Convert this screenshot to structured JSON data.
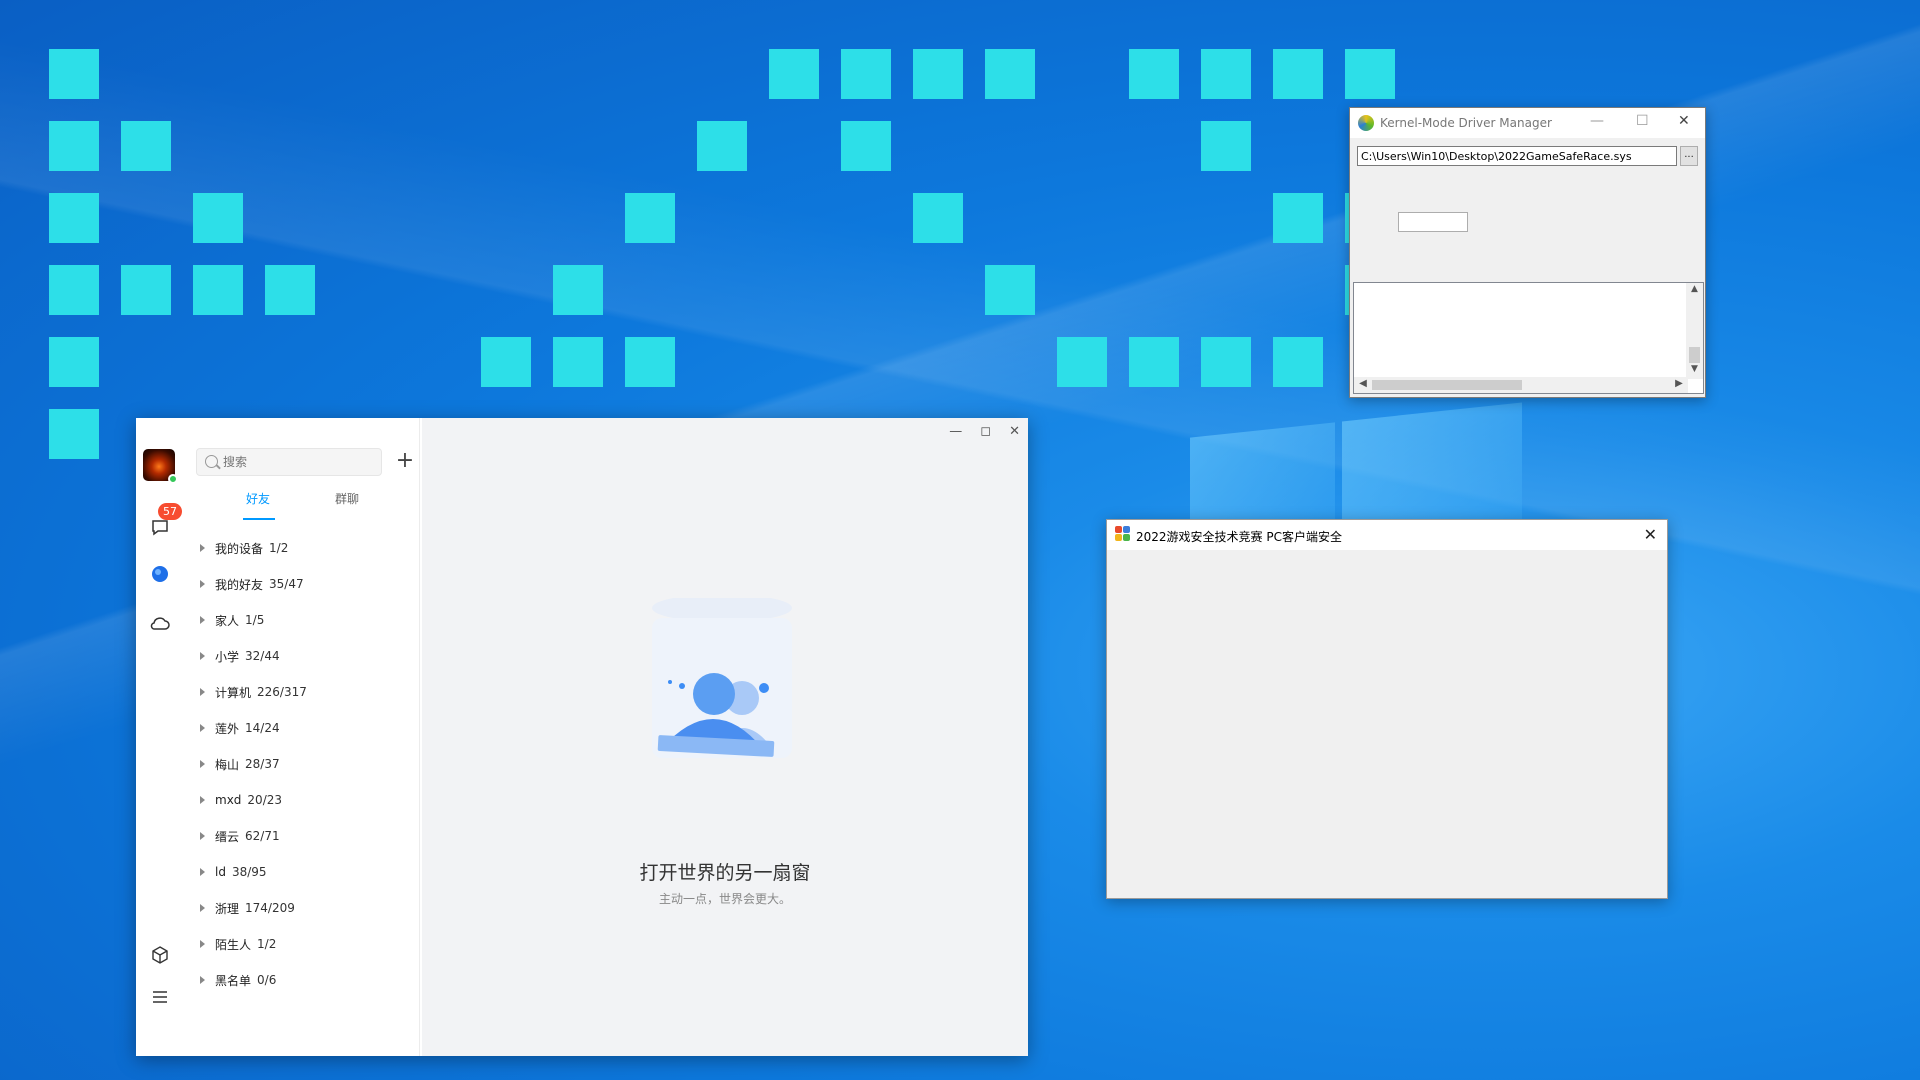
{
  "desktop": {
    "tiles_color": "#2ddfe8"
  },
  "qq": {
    "window_controls": {
      "minimize": "—",
      "maximize": "◻",
      "close": "✕"
    },
    "badge_count": "57",
    "search": {
      "placeholder": "搜索",
      "add_label": "+"
    },
    "tabs": [
      "好友",
      "群聊"
    ],
    "groups": [
      {
        "name": "我的设备",
        "count": "1/2"
      },
      {
        "name": "我的好友",
        "count": "35/47"
      },
      {
        "name": "家人",
        "count": "1/5"
      },
      {
        "name": "小学",
        "count": "32/44"
      },
      {
        "name": "计算机",
        "count": "226/317"
      },
      {
        "name": "莲外",
        "count": "14/24"
      },
      {
        "name": "梅山",
        "count": "28/37"
      },
      {
        "name": "mxd",
        "count": "20/23"
      },
      {
        "name": "缙云",
        "count": "62/71"
      },
      {
        "name": "ld",
        "count": "38/95"
      },
      {
        "name": "浙理",
        "count": "174/209"
      },
      {
        "name": "陌生人",
        "count": "1/2"
      },
      {
        "name": "黑名单",
        "count": "0/6"
      }
    ],
    "main": {
      "title": "打开世界的另一扇窗",
      "subtitle": "主动一点，世界会更大。"
    },
    "accent": "#0099ff"
  },
  "kmdm": {
    "title": "Kernel-Mode Driver Manager",
    "controls": {
      "minimize": "—",
      "maximize": "☐",
      "close": "✕"
    },
    "path": "C:\\Users\\Win10\\Desktop\\2022GameSafeRace.sys",
    "browse_label": "...",
    "scroll": {
      "up": "▲",
      "down": "▼",
      "left": "◀",
      "right": "▶"
    }
  },
  "gamesafe": {
    "title": "2022游戏安全技术竞赛 PC客户端安全",
    "close": "✕"
  }
}
